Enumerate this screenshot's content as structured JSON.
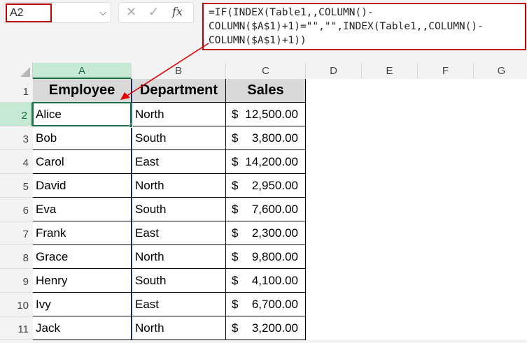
{
  "name_box": {
    "value": "A2",
    "dropdown_icon": "chevron-down-icon"
  },
  "formula_bar": {
    "cancel_icon": "✕",
    "enter_icon": "✓",
    "fx_label": "fx",
    "formula_lines": [
      "=IF(INDEX(Table1,,COLUMN()-",
      "COLUMN($A$1)+1)=\"\",\"\",INDEX(Table1,,COLUMN()-",
      "COLUMN($A$1)+1))"
    ]
  },
  "columns": [
    "A",
    "B",
    "C",
    "D",
    "E",
    "F",
    "G"
  ],
  "rows": [
    "1",
    "2",
    "3",
    "4",
    "5",
    "6",
    "7",
    "8",
    "9",
    "10",
    "11"
  ],
  "selected_cell": "A2",
  "annotation_color": "#c00000",
  "table": {
    "headers": [
      "Employee",
      "Department",
      "Sales"
    ],
    "rows": [
      {
        "employee": "Alice",
        "department": "North",
        "currency": "$",
        "sales": "12,500.00"
      },
      {
        "employee": "Bob",
        "department": "South",
        "currency": "$",
        "sales": "3,800.00"
      },
      {
        "employee": "Carol",
        "department": "East",
        "currency": "$",
        "sales": "14,200.00"
      },
      {
        "employee": "David",
        "department": "North",
        "currency": "$",
        "sales": "2,950.00"
      },
      {
        "employee": "Eva",
        "department": "South",
        "currency": "$",
        "sales": "7,600.00"
      },
      {
        "employee": "Frank",
        "department": "East",
        "currency": "$",
        "sales": "2,300.00"
      },
      {
        "employee": "Grace",
        "department": "North",
        "currency": "$",
        "sales": "9,800.00"
      },
      {
        "employee": "Henry",
        "department": "South",
        "currency": "$",
        "sales": "4,100.00"
      },
      {
        "employee": "Ivy",
        "department": "East",
        "currency": "$",
        "sales": "6,700.00"
      },
      {
        "employee": "Jack",
        "department": "North",
        "currency": "$",
        "sales": "3,200.00"
      }
    ]
  }
}
